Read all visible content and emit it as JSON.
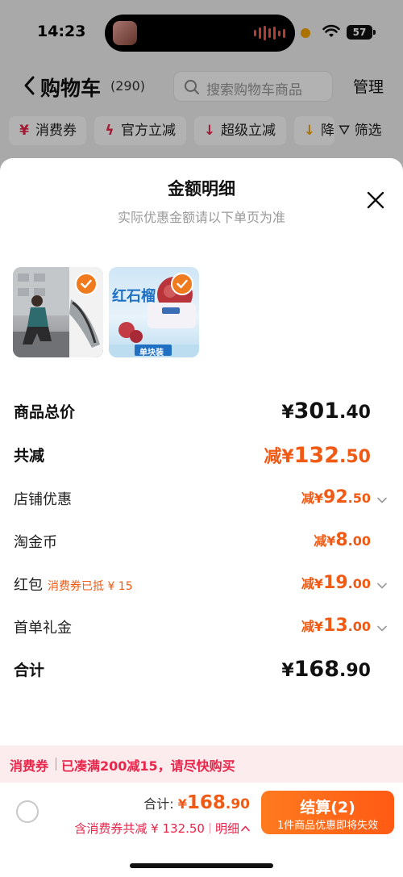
{
  "status_bar": {
    "time": "14:23",
    "battery": "57"
  },
  "header": {
    "title": "购物车",
    "count": "(290)",
    "search_placeholder": "搜索购物车商品",
    "manage": "管理"
  },
  "filters": [
    {
      "label": "消费券",
      "icon": "coupon-icon"
    },
    {
      "label": "官方立减",
      "icon": "lightning-icon"
    },
    {
      "label": "超级立减",
      "icon": "arrow-down-icon"
    },
    {
      "label": "降",
      "icon": "price-drop-icon"
    }
  ],
  "filter_button": "筛选",
  "sheet": {
    "title": "金额明细",
    "subtitle": "实际优惠金额请以下单页为准",
    "products": [
      {
        "name": "shoe-product",
        "thumb_text": ""
      },
      {
        "name": "soap-product",
        "thumb_text": "红石榴",
        "thumb_badge": "单块装"
      }
    ],
    "rows": {
      "total_price": {
        "label": "商品总价",
        "currency": "¥",
        "int": "301",
        "dec": ".40"
      },
      "total_discount": {
        "label": "共减",
        "prefix": "减¥",
        "int": "132",
        "dec": ".50"
      },
      "store_discount": {
        "label": "店铺优惠",
        "prefix": "减¥",
        "int": "92",
        "dec": ".50"
      },
      "coins": {
        "label": "淘金币",
        "prefix": "减¥",
        "int": "8",
        "dec": ".00"
      },
      "red_packet": {
        "label": "红包",
        "note": "消费券已抵 ¥ 15",
        "prefix": "减¥",
        "int": "19",
        "dec": ".00"
      },
      "first_order": {
        "label": "首单礼金",
        "prefix": "减¥",
        "int": "13",
        "dec": ".00"
      },
      "sum": {
        "label": "合计",
        "currency": "¥",
        "int": "168",
        "dec": ".90"
      }
    }
  },
  "promo": {
    "tag": "消费券",
    "text": "已凑满200减15，请尽快购买"
  },
  "footer": {
    "total_label": "合计: ",
    "total_currency": "¥",
    "total_int": "168",
    "total_dec": ".90",
    "discount_text": "含消费券共减 ¥ 132.50",
    "detail_label": "明细",
    "checkout_label": "结算(2)",
    "checkout_sub": "1件商品优惠即将失效"
  },
  "colors": {
    "accent": "#f05a14",
    "promo": "#e8254a",
    "promo_bg": "#fdecee"
  }
}
